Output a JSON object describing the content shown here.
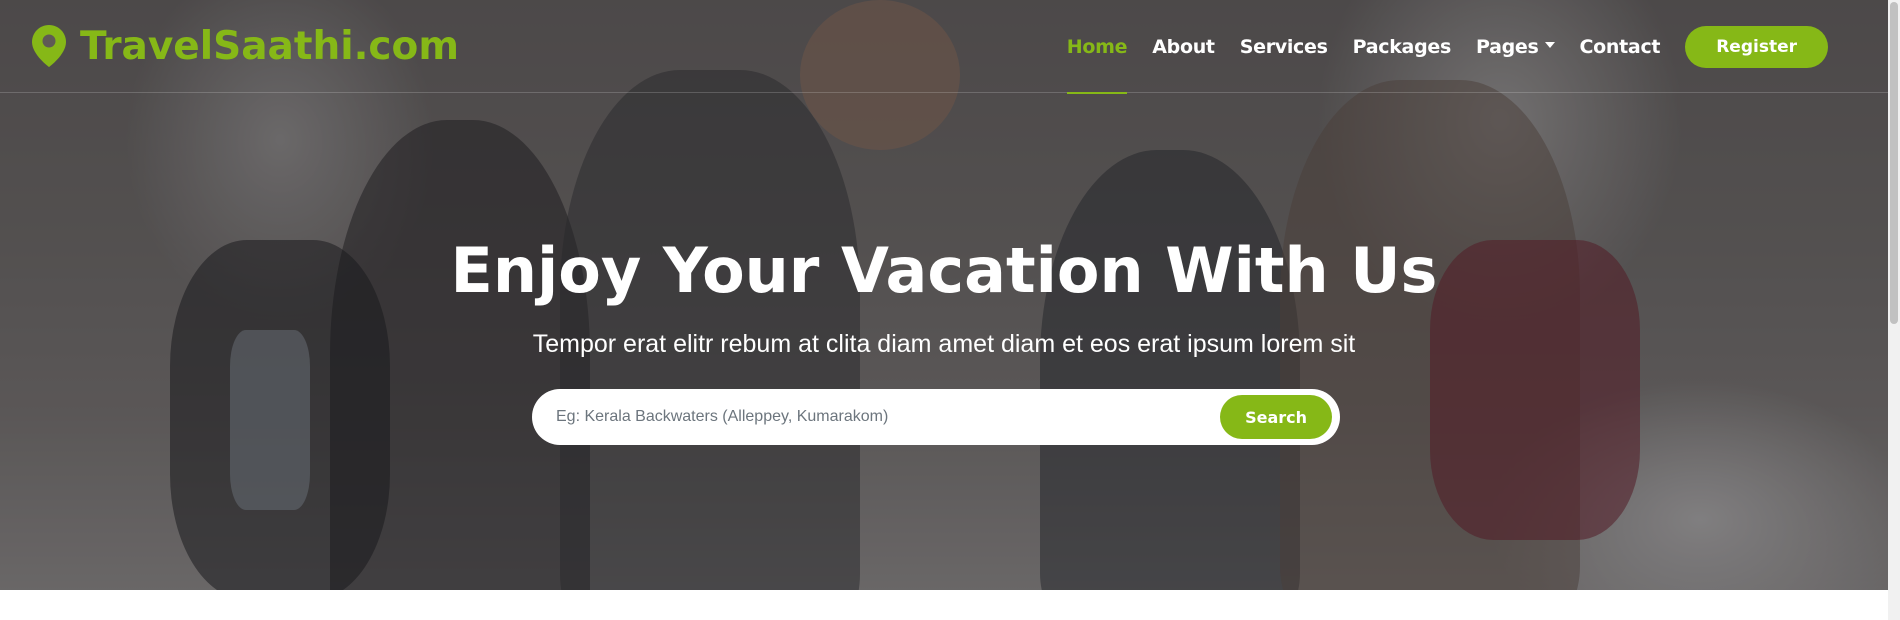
{
  "brand": {
    "name": "TravelSaathi.com",
    "icon": "map-marker-icon",
    "color": "#86b817"
  },
  "nav": {
    "items": [
      {
        "label": "Home",
        "active": true
      },
      {
        "label": "About",
        "active": false
      },
      {
        "label": "Services",
        "active": false
      },
      {
        "label": "Packages",
        "active": false
      },
      {
        "label": "Pages",
        "active": false,
        "dropdown": true
      },
      {
        "label": "Contact",
        "active": false
      }
    ],
    "register_label": "Register"
  },
  "hero": {
    "title": "Enjoy Your Vacation With Us",
    "subtitle": "Tempor erat elitr rebum at clita diam amet diam et eos erat ipsum lorem sit",
    "search": {
      "placeholder": "Eg: Kerala Backwaters (Alleppey, Kumarakom)",
      "value": "",
      "button_label": "Search"
    }
  },
  "colors": {
    "accent": "#86b817",
    "overlay": "rgba(20,24,32,0.48)"
  }
}
